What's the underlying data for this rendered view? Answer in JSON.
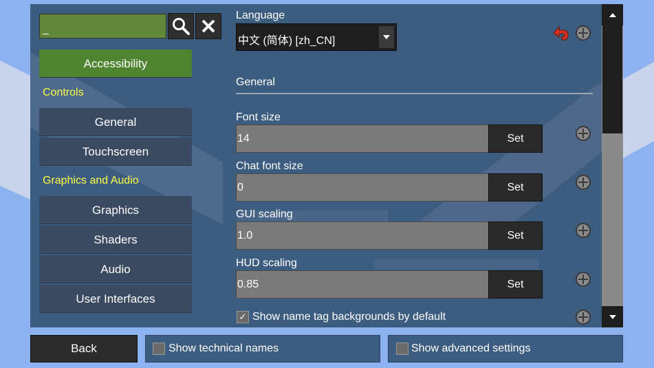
{
  "search": {
    "value": "_"
  },
  "icons": {
    "search": "search-icon",
    "clear": "close-icon",
    "dropdown": "chevron-down-icon",
    "language_reset": "back-arrow-icon",
    "reset": "reset-icon",
    "scroll_up": "chevron-up-icon",
    "scroll_down": "chevron-down-icon"
  },
  "sidebar": {
    "items": [
      {
        "label": "Accessibility",
        "active": true
      },
      {
        "header": "Controls"
      },
      {
        "label": "General"
      },
      {
        "label": "Touchscreen"
      },
      {
        "header": "Graphics and Audio"
      },
      {
        "label": "Graphics"
      },
      {
        "label": "Shaders"
      },
      {
        "label": "Audio"
      },
      {
        "label": "User Interfaces"
      }
    ]
  },
  "language": {
    "label": "Language",
    "value": "中文 (简体) [zh_CN]"
  },
  "section": {
    "title": "General"
  },
  "settings": [
    {
      "label": "Font size",
      "value": "14",
      "button": "Set"
    },
    {
      "label": "Chat font size",
      "value": "0",
      "button": "Set"
    },
    {
      "label": "GUI scaling",
      "value": "1.0",
      "button": "Set"
    },
    {
      "label": "HUD scaling",
      "value": "0.85",
      "button": "Set"
    }
  ],
  "name_tag_bg": {
    "label": "Show name tag backgrounds by default",
    "checked": true
  },
  "bottom": {
    "back_label": "Back",
    "technical_names_label": "Show technical names",
    "technical_names_checked": false,
    "advanced_label": "Show advanced settings",
    "advanced_checked": false
  },
  "colors": {
    "panel": "#3d5d80",
    "active_category": "#4f8430",
    "category_header": "#ffff44",
    "background": "#8cb3f0"
  }
}
